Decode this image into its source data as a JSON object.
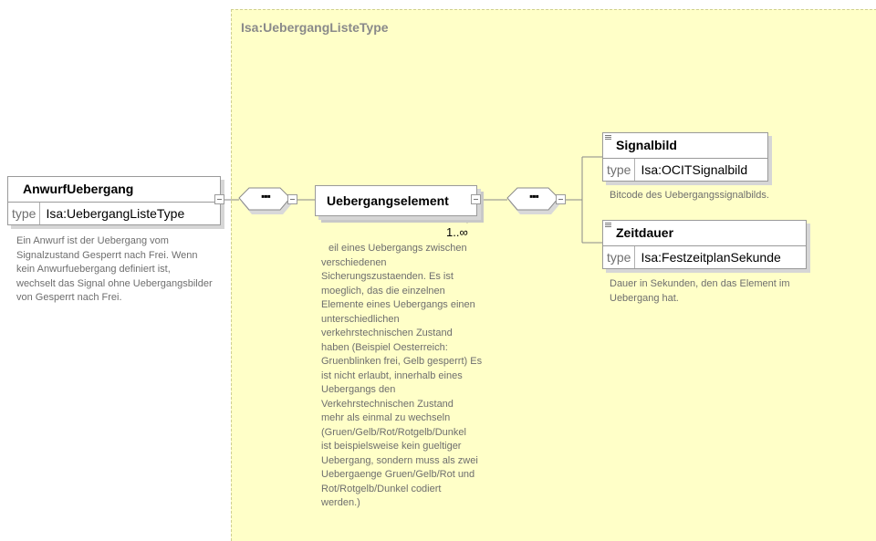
{
  "type_area": {
    "title": "Isa:UebergangListeType"
  },
  "root": {
    "name": "AnwurfUebergang",
    "type_label": "type",
    "type_value": "Isa:UebergangListeType",
    "doc": [
      "Ein Anwurf ist der Uebergang vom",
      "Signalzustand Gesperrt nach Frei. Wenn",
      "kein Anwurfuebergang definiert ist,",
      "wechselt das Signal ohne Uebergangsbilder",
      "von Gesperrt nach Frei."
    ]
  },
  "sequence_symbol": "▪▪▪",
  "element": {
    "name": "Uebergangselement",
    "multiplicity": "1..∞",
    "doc": [
      "eil eines Uebergangs zwischen",
      "verschiedenen",
      "Sicherungszustaenden. Es ist",
      "moeglich, das die einzelnen",
      "Elemente eines Uebergangs einen",
      "unterschiedlichen",
      "verkehrstechnischen Zustand",
      "haben (Beispiel Oesterreich:",
      "Gruenblinken frei, Gelb gesperrt) Es",
      "ist nicht erlaubt, innerhalb eines",
      "Uebergangs den",
      "Verkehrstechnischen Zustand",
      "mehr als einmal zu wechseln",
      "(Gruen/Gelb/Rot/Rotgelb/Dunkel",
      "ist beispielsweise kein gueltiger",
      "Uebergang, sondern muss als zwei",
      "Uebergaenge Gruen/Gelb/Rot und",
      "Rot/Rotgelb/Dunkel codiert",
      "werden.)"
    ]
  },
  "children": [
    {
      "name": "Signalbild",
      "type_label": "type",
      "type_value": "Isa:OCITSignalbild",
      "doc": [
        "Bitcode des Uebergangssignalbilds."
      ]
    },
    {
      "name": "Zeitdauer",
      "type_label": "type",
      "type_value": "Isa:FestzeitplanSekunde",
      "doc": [
        "Dauer in Sekunden, den das Element im",
        "Uebergang hat."
      ]
    }
  ]
}
